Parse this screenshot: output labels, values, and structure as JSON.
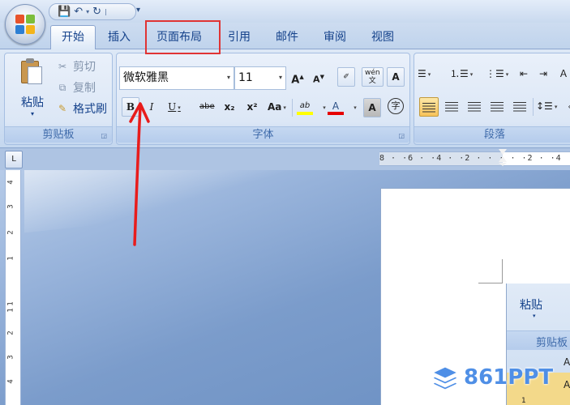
{
  "quick_access": {
    "more_label": "▾"
  },
  "tabs": [
    {
      "label": "开始",
      "active": true
    },
    {
      "label": "插入"
    },
    {
      "label": "页面布局",
      "highlighted": true
    },
    {
      "label": "引用"
    },
    {
      "label": "邮件"
    },
    {
      "label": "审阅"
    },
    {
      "label": "视图"
    }
  ],
  "clipboard": {
    "group_label": "剪贴板",
    "paste_label": "粘贴",
    "cut_label": "剪切",
    "copy_label": "复制",
    "format_painter_label": "格式刷"
  },
  "font": {
    "group_label": "字体",
    "font_name": "微软雅黑",
    "font_size": "11",
    "grow_label": "A",
    "shrink_label": "A",
    "phonetic_label": "wén",
    "bold_label": "B",
    "italic_label": "I",
    "underline_label": "U",
    "strike_label": "abe",
    "subscript_label": "x₂",
    "superscript_label": "x²",
    "case_label": "Aa",
    "highlight_label": "ab",
    "font_color_label": "A",
    "shading_label": "A",
    "enclose_label": "字",
    "highlight_color": "#ffff00",
    "font_color": "#e60000"
  },
  "paragraph": {
    "group_label": "段落"
  },
  "ruler": {
    "corner_label": "L",
    "horizontal_text": "8 · ·6 · ·4 · ·2 · · · · ·2 · ·4",
    "vertical_marks": [
      "4",
      "3",
      "2",
      "1",
      "1",
      "1",
      "2",
      "3",
      "4"
    ]
  },
  "thumbnail": {
    "paste_label": "粘贴",
    "clipboard_label": "剪贴板",
    "letter_a": "A",
    "line_number": "1"
  },
  "watermark": {
    "text": "861PPT"
  },
  "colors": {
    "accent": "#15428b",
    "annotation_red": "#e03434"
  }
}
